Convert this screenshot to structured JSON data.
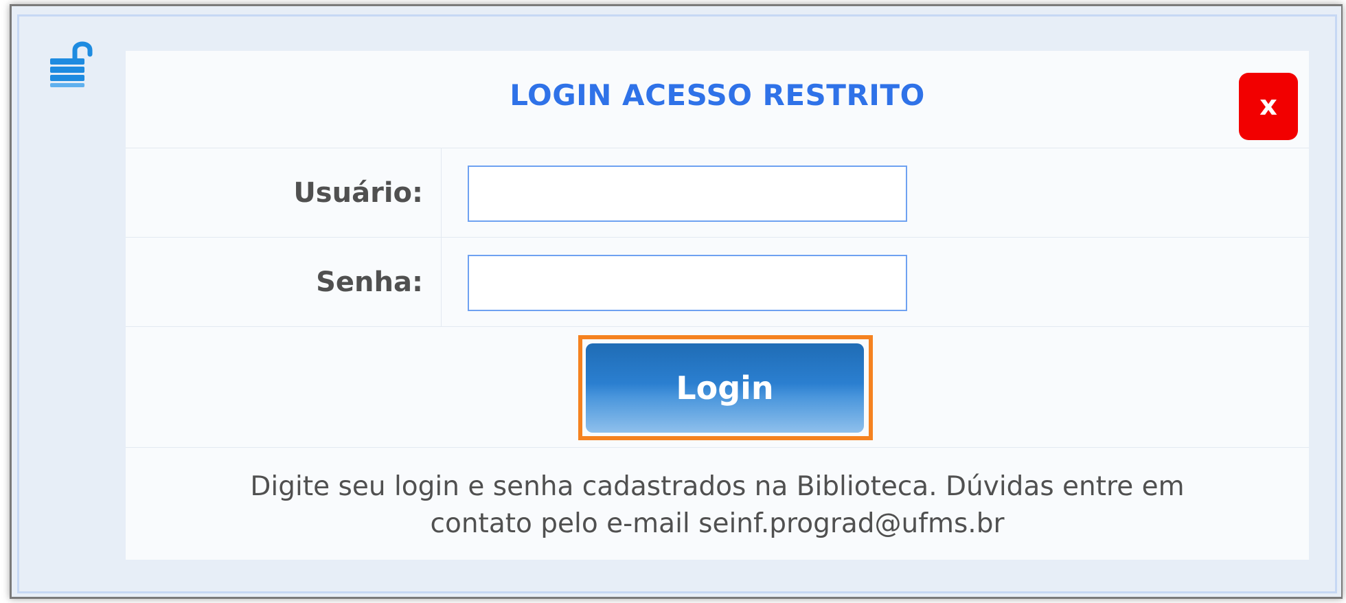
{
  "dialog": {
    "title": "LOGIN ACESSO RESTRITO",
    "close_label": "x",
    "lock_icon": "unlocked-padlock-icon"
  },
  "form": {
    "user_label": "Usuário:",
    "user_value": "",
    "password_label": "Senha:",
    "password_value": ""
  },
  "actions": {
    "login_label": "Login"
  },
  "footer": {
    "help_line_1": "Digite seu login e senha cadastrados na Biblioteca. Dúvidas entre em",
    "help_line_2": "contato pelo e-mail seinf.prograd@ufms.br"
  },
  "colors": {
    "title": "#2f72e8",
    "close_button": "#f20000",
    "login_button": "#2b7fd0",
    "highlight": "#f58220",
    "background": "#e7eef7"
  }
}
